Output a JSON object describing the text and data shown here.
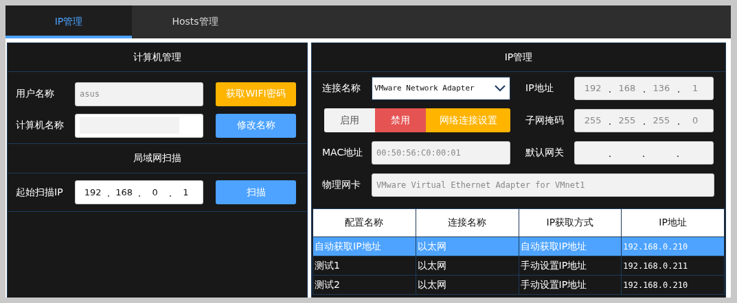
{
  "tabs": [
    {
      "label": "IP管理",
      "selected": true
    },
    {
      "label": "Hosts管理",
      "selected": false
    }
  ],
  "computer_panel": {
    "title": "计算机管理",
    "user_name": {
      "label": "用户名称",
      "value": "asus",
      "button": "获取WIFI密码"
    },
    "computer_name": {
      "label": "计算机名称",
      "button": "修改名称"
    }
  },
  "scan_panel": {
    "title": "局域网扫描",
    "label": "起始扫描IP",
    "octets": [
      "192",
      "168",
      "0",
      "1"
    ],
    "button": "扫描"
  },
  "ip_panel": {
    "title": "IP管理",
    "connection": {
      "label": "连接名称",
      "value": "VMware Network Adapter"
    },
    "ip_address": {
      "label": "IP地址",
      "octets": [
        "192",
        "168",
        "136",
        "1"
      ]
    },
    "actions": [
      {
        "label": "启用",
        "kind": "neutral"
      },
      {
        "label": "禁用",
        "kind": "danger"
      },
      {
        "label": "网络连接设置",
        "kind": "warning"
      }
    ],
    "subnet_mask": {
      "label": "子网掩码",
      "octets": [
        "255",
        "255",
        "255",
        "0"
      ]
    },
    "mac": {
      "label": "MAC地址",
      "value": "00:50:56:C0:00:01"
    },
    "gateway": {
      "label": "默认网关"
    },
    "adapter": {
      "label": "物理网卡",
      "value": "VMware Virtual Ethernet Adapter for VMnet1"
    }
  },
  "table": {
    "columns": [
      "配置名称",
      "连接名称",
      "IP获取方式",
      "IP地址"
    ],
    "rows": [
      {
        "cells": [
          "自动获取IP地址",
          "以太网",
          "自动获取IP地址",
          "192.168.0.210"
        ],
        "selected": true
      },
      {
        "cells": [
          "测试1",
          "以太网",
          "手动设置IP地址",
          "192.168.0.211"
        ],
        "selected": false
      },
      {
        "cells": [
          "测试2",
          "以太网",
          "手动设置IP地址",
          "192.168.0.210"
        ],
        "selected": false
      }
    ]
  }
}
